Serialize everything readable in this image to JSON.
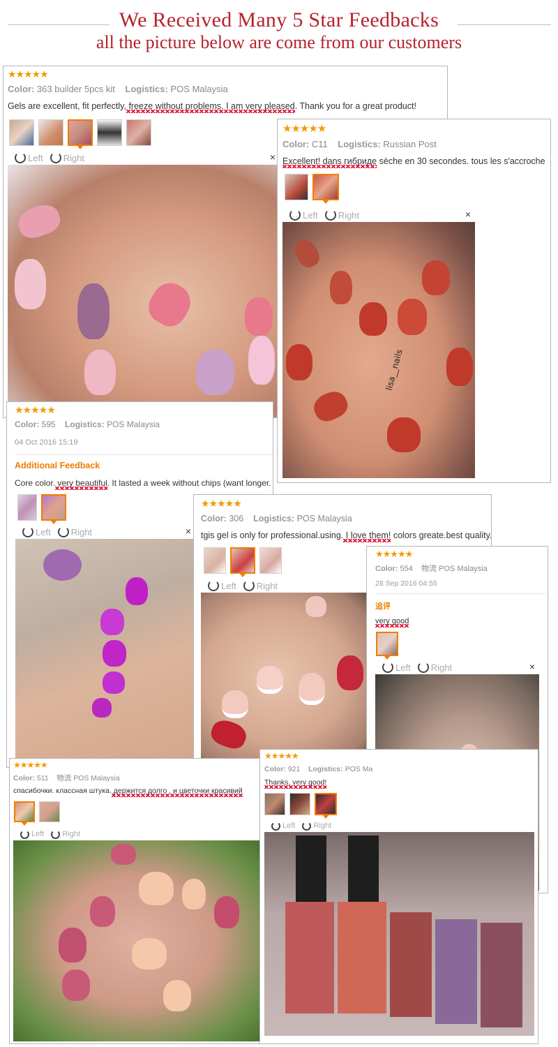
{
  "header": {
    "title": "We Received Many 5 Star Feedbacks",
    "subtitle": "all the picture below are come from our customers"
  },
  "ui": {
    "stars": "★★★★★",
    "color_label": "Color:",
    "logistics_label": "Logistics:",
    "left_label": "Left",
    "right_label": "Right",
    "close": "×",
    "additional_feedback": "Additional Feedback"
  },
  "reviews": [
    {
      "color": "363 builder 5pcs kit",
      "logistics": "POS Malaysia",
      "text_a": "Gels are excellent, fit perfectly,",
      "text_hl": " freeze without problems. I am very pleased",
      "text_b": ". Thank you for a great product!"
    },
    {
      "color": "C11",
      "logistics": "Russian Post",
      "text_a": "",
      "text_hl": "Excellent! dans гибриде",
      "text_b": " sèche en 30 secondes. tous les s'accroche",
      "watermark": "lisa__nails"
    },
    {
      "color": "595",
      "logistics": "POS Malaysia",
      "date": "04 Oct 2016 15:19",
      "text_a": "Core color.",
      "text_hl": " very beautiful",
      "text_b": ". It lasted a week without chips (want longer."
    },
    {
      "color": "306",
      "logistics": "POS Malaysia",
      "text_a": "tgis gel is only for professional.using.",
      "text_hl": " I love them!",
      "text_b": " colors greate.best quality."
    },
    {
      "color": "554",
      "logistics_cn": "物流",
      "logistics": "POS Malaysia",
      "date": "28 Sep 2016 04:55",
      "addl_cn": "追评",
      "text_a": "",
      "text_hl": "very good",
      "text_b": ""
    },
    {
      "color": "511",
      "logistics_cn": "物流",
      "logistics": "POS Malaysia",
      "text_a": "спасибочки. классная штука.",
      "text_hl": " держится долго . и цветочки красивий",
      "text_b": ""
    },
    {
      "color": "921",
      "logistics": "POS Ma",
      "text_a": "",
      "text_hl": "Thanks, very good!",
      "text_b": ""
    }
  ],
  "colors": {
    "title_red": "#b6222b",
    "star_orange": "#f39800",
    "accent_orange": "#f07d00",
    "wave_red": "#e0173c"
  }
}
